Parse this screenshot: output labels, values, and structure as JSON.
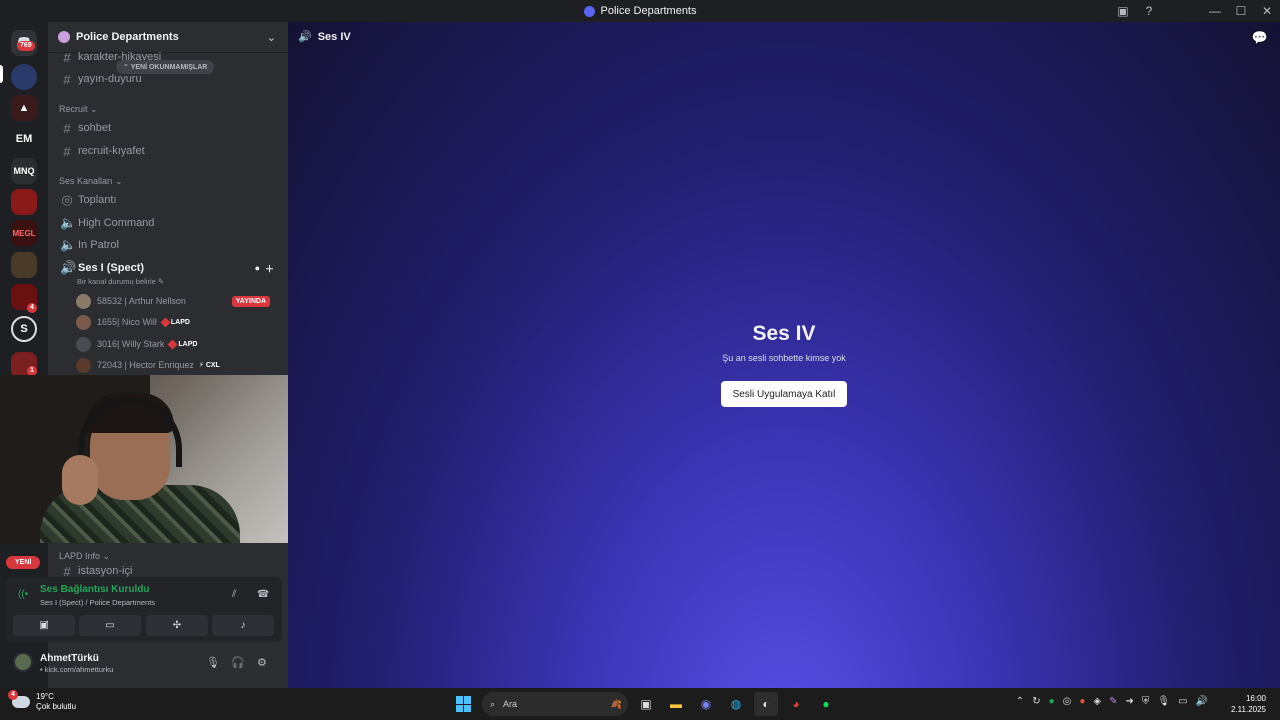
{
  "window": {
    "title": "Police Departments"
  },
  "rail": {
    "servers": [
      {
        "label": "",
        "badge": "769",
        "color": "#313338"
      },
      {
        "label": "",
        "badge": "",
        "color": "#2a3a6a"
      },
      {
        "label": "",
        "badge": "",
        "color": "#3a1a1a"
      },
      {
        "label": "EM",
        "badge": "",
        "color": "#1e1f22"
      },
      {
        "label": "MNQ",
        "badge": "",
        "color": "#2b2d31"
      },
      {
        "label": "",
        "badge": "",
        "color": "#8a1a1a"
      },
      {
        "label": "MEGL",
        "badge": "",
        "color": "#3a1010"
      },
      {
        "label": "",
        "badge": "",
        "color": "#4a3a2a"
      },
      {
        "label": "",
        "badge": "4",
        "color": "#6a1010"
      },
      {
        "label": "S",
        "badge": "",
        "color": "#1e1f22"
      },
      {
        "label": "",
        "badge": "1",
        "color": "#7a2020"
      }
    ]
  },
  "sidebar": {
    "guild_name": "Police Departments",
    "unread_label": "YENİ OKUNMAMIŞLAR",
    "channels_top": [
      {
        "name": "karakter-hikayesi"
      },
      {
        "name": "yayın-duyuru"
      }
    ],
    "category_recruit": "Recruit",
    "recruit_channels": [
      {
        "name": "sohbet"
      },
      {
        "name": "recruit-kıyafet"
      }
    ],
    "category_voice": "Ses Kanalları",
    "voice_channels": [
      {
        "name": "Toplantı"
      },
      {
        "name": "High Command"
      },
      {
        "name": "In Patrol"
      }
    ],
    "active_voice": {
      "name": "Ses I (Spect)",
      "status_hint": "Bir kanal durumu belirle"
    },
    "voice_users": [
      {
        "name": "58532 | Arthur Nellson",
        "tag": "",
        "live": "YAYINDA"
      },
      {
        "name": "1655| Nico Will",
        "tag": "LAPD",
        "live": ""
      },
      {
        "name": "3016| Willy Stark",
        "tag": "LAPD",
        "live": ""
      },
      {
        "name": "72043 | Hector Enriquez",
        "tag": "CXL",
        "live": ""
      }
    ],
    "category_lapd": "LAPD Info",
    "lapd_channel": "istasyon-içi",
    "new_badge": "YENİ"
  },
  "voice_panel": {
    "status": "Ses Bağlantısı Kuruldu",
    "location": "Ses I (Spect) / Police Departments"
  },
  "user_panel": {
    "username": "AhmetTürkü",
    "status": "• kick.com/ahmetturku"
  },
  "main": {
    "header_channel": "Ses IV",
    "title": "Ses IV",
    "subtitle": "Şu an sesli sohbette kimse yok",
    "join_button": "Sesli Uygulamaya Katıl"
  },
  "taskbar": {
    "temp": "19°C",
    "weather": "Çok bulutlu",
    "weather_badge": "4",
    "search_placeholder": "Ara",
    "time": "16:00",
    "date": "2.11.2025"
  },
  "colors": {
    "accent": "#5865f2",
    "connected_green": "#23a55a",
    "live_red": "#da373c"
  }
}
